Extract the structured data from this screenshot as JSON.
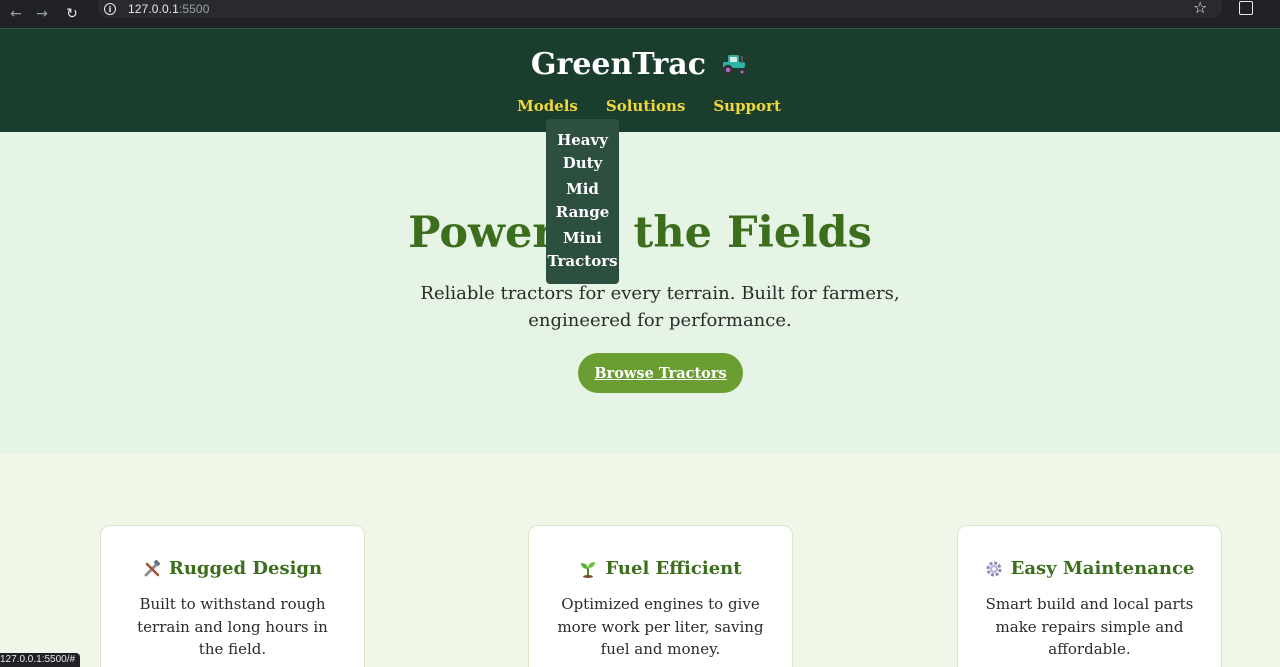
{
  "browser": {
    "url_host": "127.0.0.1",
    "url_port": ":5500",
    "status_url": "127.0.0.1:5500/#"
  },
  "header": {
    "brand": "GreenTrac",
    "nav": [
      {
        "label": "Models"
      },
      {
        "label": "Solutions"
      },
      {
        "label": "Support"
      }
    ]
  },
  "dropdown": {
    "items": [
      {
        "label": "Heavy Duty"
      },
      {
        "label": "Mid Range"
      },
      {
        "label": "Mini Tractors"
      }
    ]
  },
  "hero": {
    "title": "Power to the Fields",
    "subtitle": "Reliable tractors for every terrain. Built for farmers, engineered for performance.",
    "button": "Browse Tractors"
  },
  "features": [
    {
      "icon": "tools-icon",
      "title": "Rugged Design",
      "text": "Built to withstand rough terrain and long hours in the field."
    },
    {
      "icon": "seedling-icon",
      "title": "Fuel Efficient",
      "text": "Optimized engines to give more work per liter, saving fuel and money."
    },
    {
      "icon": "gear-icon",
      "title": "Easy Maintenance",
      "text": "Smart build and local parts make repairs simple and affordable."
    }
  ],
  "colors": {
    "header_bg": "#1b3d2e",
    "nav_link": "#f0d73a",
    "accent_green": "#3c6e1d",
    "button_bg": "#6b9e32",
    "hero_bg": "#e5f4e4"
  }
}
